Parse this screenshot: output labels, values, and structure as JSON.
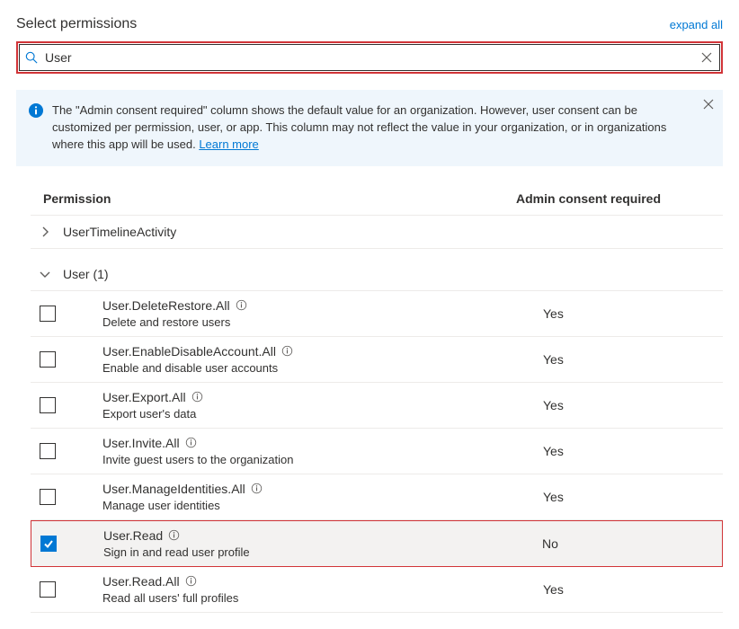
{
  "header": {
    "title": "Select permissions",
    "expand_all": "expand all"
  },
  "search": {
    "value": "User"
  },
  "banner": {
    "text": "The \"Admin consent required\" column shows the default value for an organization. However, user consent can be customized per permission, user, or app. This column may not reflect the value in your organization, or in organizations where this app will be used. ",
    "learn_more": "Learn more"
  },
  "table": {
    "col_permission": "Permission",
    "col_consent": "Admin consent required"
  },
  "categories": {
    "collapsed": {
      "label": "UserTimelineActivity"
    },
    "expanded": {
      "label": "User (1)"
    }
  },
  "permissions": [
    {
      "name": "User.DeleteRestore.All",
      "desc": "Delete and restore users",
      "consent": "Yes",
      "checked": false,
      "hl": false
    },
    {
      "name": "User.EnableDisableAccount.All",
      "desc": "Enable and disable user accounts",
      "consent": "Yes",
      "checked": false,
      "hl": false
    },
    {
      "name": "User.Export.All",
      "desc": "Export user's data",
      "consent": "Yes",
      "checked": false,
      "hl": false
    },
    {
      "name": "User.Invite.All",
      "desc": "Invite guest users to the organization",
      "consent": "Yes",
      "checked": false,
      "hl": false
    },
    {
      "name": "User.ManageIdentities.All",
      "desc": "Manage user identities",
      "consent": "Yes",
      "checked": false,
      "hl": false
    },
    {
      "name": "User.Read",
      "desc": "Sign in and read user profile",
      "consent": "No",
      "checked": true,
      "hl": true
    },
    {
      "name": "User.Read.All",
      "desc": "Read all users' full profiles",
      "consent": "Yes",
      "checked": false,
      "hl": false
    }
  ]
}
